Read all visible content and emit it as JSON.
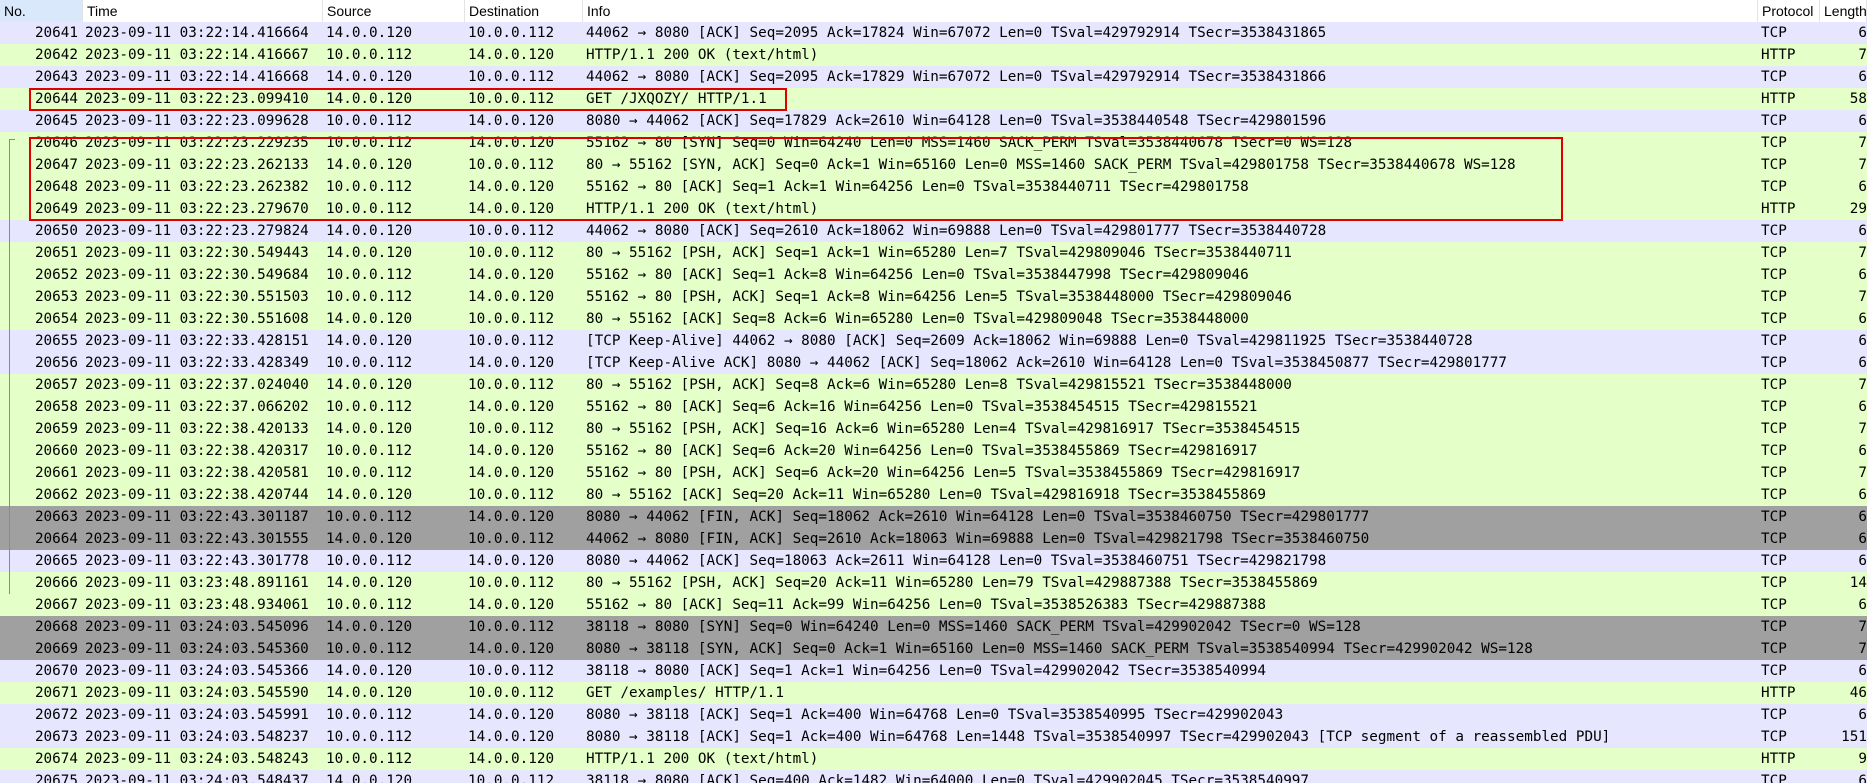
{
  "columns": {
    "no": "No.",
    "time": "Time",
    "source": "Source",
    "destination": "Destination",
    "info": "Info",
    "protocol": "Protocol",
    "length": "Length"
  },
  "packets": [
    {
      "no": "20641",
      "time": "2023-09-11 03:22:14.416664",
      "src": "14.0.0.120",
      "dst": "10.0.0.112",
      "info": "44062 → 8080 [ACK] Seq=2095 Ack=17824 Win=67072 Len=0 TSval=429792914 TSecr=3538431865",
      "proto": "TCP",
      "len": "6",
      "color": "tcp"
    },
    {
      "no": "20642",
      "time": "2023-09-11 03:22:14.416667",
      "src": "10.0.0.112",
      "dst": "14.0.0.120",
      "info": "HTTP/1.1 200 OK  (text/html)",
      "proto": "HTTP",
      "len": "7",
      "color": "http"
    },
    {
      "no": "20643",
      "time": "2023-09-11 03:22:14.416668",
      "src": "14.0.0.120",
      "dst": "10.0.0.112",
      "info": "44062 → 8080 [ACK] Seq=2095 Ack=17829 Win=67072 Len=0 TSval=429792914 TSecr=3538431866",
      "proto": "TCP",
      "len": "6",
      "color": "tcp"
    },
    {
      "no": "20644",
      "time": "2023-09-11 03:22:23.099410",
      "src": "14.0.0.120",
      "dst": "10.0.0.112",
      "info": "GET /JXQOZY/ HTTP/1.1",
      "proto": "HTTP",
      "len": "58",
      "color": "http"
    },
    {
      "no": "20645",
      "time": "2023-09-11 03:22:23.099628",
      "src": "10.0.0.112",
      "dst": "14.0.0.120",
      "info": "8080 → 44062 [ACK] Seq=17829 Ack=2610 Win=64128 Len=0 TSval=3538440548 TSecr=429801596",
      "proto": "TCP",
      "len": "6",
      "color": "tcp"
    },
    {
      "no": "20646",
      "time": "2023-09-11 03:22:23.229235",
      "src": "10.0.0.112",
      "dst": "14.0.0.120",
      "info": "55162 → 80 [SYN] Seq=0 Win=64240 Len=0 MSS=1460 SACK_PERM TSval=3538440678 TSecr=0 WS=128",
      "proto": "TCP",
      "len": "7",
      "color": "http"
    },
    {
      "no": "20647",
      "time": "2023-09-11 03:22:23.262133",
      "src": "14.0.0.120",
      "dst": "10.0.0.112",
      "info": "80 → 55162 [SYN, ACK] Seq=0 Ack=1 Win=65160 Len=0 MSS=1460 SACK_PERM TSval=429801758 TSecr=3538440678 WS=128",
      "proto": "TCP",
      "len": "7",
      "color": "http"
    },
    {
      "no": "20648",
      "time": "2023-09-11 03:22:23.262382",
      "src": "10.0.0.112",
      "dst": "14.0.0.120",
      "info": "55162 → 80 [ACK] Seq=1 Ack=1 Win=64256 Len=0 TSval=3538440711 TSecr=429801758",
      "proto": "TCP",
      "len": "6",
      "color": "http"
    },
    {
      "no": "20649",
      "time": "2023-09-11 03:22:23.279670",
      "src": "10.0.0.112",
      "dst": "14.0.0.120",
      "info": "HTTP/1.1 200 OK  (text/html)",
      "proto": "HTTP",
      "len": "29",
      "color": "http"
    },
    {
      "no": "20650",
      "time": "2023-09-11 03:22:23.279824",
      "src": "14.0.0.120",
      "dst": "10.0.0.112",
      "info": "44062 → 8080 [ACK] Seq=2610 Ack=18062 Win=69888 Len=0 TSval=429801777 TSecr=3538440728",
      "proto": "TCP",
      "len": "6",
      "color": "tcp"
    },
    {
      "no": "20651",
      "time": "2023-09-11 03:22:30.549443",
      "src": "14.0.0.120",
      "dst": "10.0.0.112",
      "info": "80 → 55162 [PSH, ACK] Seq=1 Ack=1 Win=65280 Len=7 TSval=429809046 TSecr=3538440711",
      "proto": "TCP",
      "len": "7",
      "color": "http"
    },
    {
      "no": "20652",
      "time": "2023-09-11 03:22:30.549684",
      "src": "10.0.0.112",
      "dst": "14.0.0.120",
      "info": "55162 → 80 [ACK] Seq=1 Ack=8 Win=64256 Len=0 TSval=3538447998 TSecr=429809046",
      "proto": "TCP",
      "len": "6",
      "color": "http"
    },
    {
      "no": "20653",
      "time": "2023-09-11 03:22:30.551503",
      "src": "10.0.0.112",
      "dst": "14.0.0.120",
      "info": "55162 → 80 [PSH, ACK] Seq=1 Ack=8 Win=64256 Len=5 TSval=3538448000 TSecr=429809046",
      "proto": "TCP",
      "len": "7",
      "color": "http"
    },
    {
      "no": "20654",
      "time": "2023-09-11 03:22:30.551608",
      "src": "14.0.0.120",
      "dst": "10.0.0.112",
      "info": "80 → 55162 [ACK] Seq=8 Ack=6 Win=65280 Len=0 TSval=429809048 TSecr=3538448000",
      "proto": "TCP",
      "len": "6",
      "color": "http"
    },
    {
      "no": "20655",
      "time": "2023-09-11 03:22:33.428151",
      "src": "14.0.0.120",
      "dst": "10.0.0.112",
      "info": "[TCP Keep-Alive] 44062 → 8080 [ACK] Seq=2609 Ack=18062 Win=69888 Len=0 TSval=429811925 TSecr=3538440728",
      "proto": "TCP",
      "len": "6",
      "color": "tcp"
    },
    {
      "no": "20656",
      "time": "2023-09-11 03:22:33.428349",
      "src": "10.0.0.112",
      "dst": "14.0.0.120",
      "info": "[TCP Keep-Alive ACK] 8080 → 44062 [ACK] Seq=18062 Ack=2610 Win=64128 Len=0 TSval=3538450877 TSecr=429801777",
      "proto": "TCP",
      "len": "6",
      "color": "tcp"
    },
    {
      "no": "20657",
      "time": "2023-09-11 03:22:37.024040",
      "src": "14.0.0.120",
      "dst": "10.0.0.112",
      "info": "80 → 55162 [PSH, ACK] Seq=8 Ack=6 Win=65280 Len=8 TSval=429815521 TSecr=3538448000",
      "proto": "TCP",
      "len": "7",
      "color": "http"
    },
    {
      "no": "20658",
      "time": "2023-09-11 03:22:37.066202",
      "src": "10.0.0.112",
      "dst": "14.0.0.120",
      "info": "55162 → 80 [ACK] Seq=6 Ack=16 Win=64256 Len=0 TSval=3538454515 TSecr=429815521",
      "proto": "TCP",
      "len": "6",
      "color": "http"
    },
    {
      "no": "20659",
      "time": "2023-09-11 03:22:38.420133",
      "src": "14.0.0.120",
      "dst": "10.0.0.112",
      "info": "80 → 55162 [PSH, ACK] Seq=16 Ack=6 Win=65280 Len=4 TSval=429816917 TSecr=3538454515",
      "proto": "TCP",
      "len": "7",
      "color": "http"
    },
    {
      "no": "20660",
      "time": "2023-09-11 03:22:38.420317",
      "src": "10.0.0.112",
      "dst": "14.0.0.120",
      "info": "55162 → 80 [ACK] Seq=6 Ack=20 Win=64256 Len=0 TSval=3538455869 TSecr=429816917",
      "proto": "TCP",
      "len": "6",
      "color": "http"
    },
    {
      "no": "20661",
      "time": "2023-09-11 03:22:38.420581",
      "src": "10.0.0.112",
      "dst": "14.0.0.120",
      "info": "55162 → 80 [PSH, ACK] Seq=6 Ack=20 Win=64256 Len=5 TSval=3538455869 TSecr=429816917",
      "proto": "TCP",
      "len": "7",
      "color": "http"
    },
    {
      "no": "20662",
      "time": "2023-09-11 03:22:38.420744",
      "src": "14.0.0.120",
      "dst": "10.0.0.112",
      "info": "80 → 55162 [ACK] Seq=20 Ack=11 Win=65280 Len=0 TSval=429816918 TSecr=3538455869",
      "proto": "TCP",
      "len": "6",
      "color": "http"
    },
    {
      "no": "20663",
      "time": "2023-09-11 03:22:43.301187",
      "src": "10.0.0.112",
      "dst": "14.0.0.120",
      "info": "8080 → 44062 [FIN, ACK] Seq=18062 Ack=2610 Win=64128 Len=0 TSval=3538460750 TSecr=429801777",
      "proto": "TCP",
      "len": "6",
      "color": "gray"
    },
    {
      "no": "20664",
      "time": "2023-09-11 03:22:43.301555",
      "src": "14.0.0.120",
      "dst": "10.0.0.112",
      "info": "44062 → 8080 [FIN, ACK] Seq=2610 Ack=18063 Win=69888 Len=0 TSval=429821798 TSecr=3538460750",
      "proto": "TCP",
      "len": "6",
      "color": "gray"
    },
    {
      "no": "20665",
      "time": "2023-09-11 03:22:43.301778",
      "src": "10.0.0.112",
      "dst": "14.0.0.120",
      "info": "8080 → 44062 [ACK] Seq=18063 Ack=2611 Win=64128 Len=0 TSval=3538460751 TSecr=429821798",
      "proto": "TCP",
      "len": "6",
      "color": "tcp"
    },
    {
      "no": "20666",
      "time": "2023-09-11 03:23:48.891161",
      "src": "14.0.0.120",
      "dst": "10.0.0.112",
      "info": "80 → 55162 [PSH, ACK] Seq=20 Ack=11 Win=65280 Len=79 TSval=429887388 TSecr=3538455869",
      "proto": "TCP",
      "len": "14",
      "color": "http"
    },
    {
      "no": "20667",
      "time": "2023-09-11 03:23:48.934061",
      "src": "10.0.0.112",
      "dst": "14.0.0.120",
      "info": "55162 → 80 [ACK] Seq=11 Ack=99 Win=64256 Len=0 TSval=3538526383 TSecr=429887388",
      "proto": "TCP",
      "len": "6",
      "color": "http"
    },
    {
      "no": "20668",
      "time": "2023-09-11 03:24:03.545096",
      "src": "14.0.0.120",
      "dst": "10.0.0.112",
      "info": "38118 → 8080 [SYN] Seq=0 Win=64240 Len=0 MSS=1460 SACK_PERM TSval=429902042 TSecr=0 WS=128",
      "proto": "TCP",
      "len": "7",
      "color": "gray"
    },
    {
      "no": "20669",
      "time": "2023-09-11 03:24:03.545360",
      "src": "10.0.0.112",
      "dst": "14.0.0.120",
      "info": "8080 → 38118 [SYN, ACK] Seq=0 Ack=1 Win=65160 Len=0 MSS=1460 SACK_PERM TSval=3538540994 TSecr=429902042 WS=128",
      "proto": "TCP",
      "len": "7",
      "color": "gray"
    },
    {
      "no": "20670",
      "time": "2023-09-11 03:24:03.545366",
      "src": "14.0.0.120",
      "dst": "10.0.0.112",
      "info": "38118 → 8080 [ACK] Seq=1 Ack=1 Win=64256 Len=0 TSval=429902042 TSecr=3538540994",
      "proto": "TCP",
      "len": "6",
      "color": "tcp"
    },
    {
      "no": "20671",
      "time": "2023-09-11 03:24:03.545590",
      "src": "14.0.0.120",
      "dst": "10.0.0.112",
      "info": "GET /examples/ HTTP/1.1",
      "proto": "HTTP",
      "len": "46",
      "color": "http"
    },
    {
      "no": "20672",
      "time": "2023-09-11 03:24:03.545991",
      "src": "10.0.0.112",
      "dst": "14.0.0.120",
      "info": "8080 → 38118 [ACK] Seq=1 Ack=400 Win=64768 Len=0 TSval=3538540995 TSecr=429902043",
      "proto": "TCP",
      "len": "6",
      "color": "tcp"
    },
    {
      "no": "20673",
      "time": "2023-09-11 03:24:03.548237",
      "src": "10.0.0.112",
      "dst": "14.0.0.120",
      "info": "8080 → 38118 [ACK] Seq=1 Ack=400 Win=64768 Len=1448 TSval=3538540997 TSecr=429902043 [TCP segment of a reassembled PDU]",
      "proto": "TCP",
      "len": "151",
      "color": "tcp"
    },
    {
      "no": "20674",
      "time": "2023-09-11 03:24:03.548243",
      "src": "10.0.0.112",
      "dst": "14.0.0.120",
      "info": "HTTP/1.1 200 OK  (text/html)",
      "proto": "HTTP",
      "len": "9",
      "color": "http"
    },
    {
      "no": "20675",
      "time": "2023-09-11 03:24:03.548437",
      "src": "14.0.0.120",
      "dst": "10.0.0.112",
      "info": "38118 → 8080 [ACK] Seq=400 Ack=1482 Win=64000 Len=0 TSval=429902045 TSecr=3538540997",
      "proto": "TCP",
      "len": "6",
      "color": "tcp"
    }
  ],
  "colors": {
    "tcp": "#e7e6ff",
    "http": "#e4ffc7",
    "gray": "#a0a0a0",
    "highlight_box": "#e00000"
  }
}
